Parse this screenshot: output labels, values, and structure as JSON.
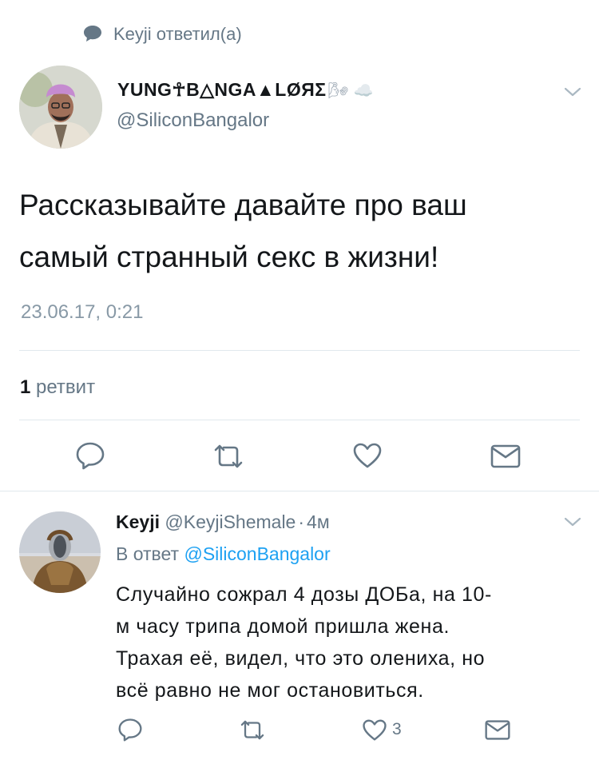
{
  "retweet_context": {
    "icon": "speech-bubble-icon",
    "text": "Keyji ответил(а)"
  },
  "main_tweet": {
    "display_name": "YUNG☥B△NGA▲LØЯΣ",
    "name_emoji": "🌬 ☁️",
    "handle": "@SiliconBangalor",
    "text_line1": "Рассказывайте давайте про ваш",
    "text_line2": "самый странный секс в жизни!",
    "timestamp": "23.06.17, 0:21",
    "retweet_count": "1",
    "retweet_label": "ретвит",
    "actions": [
      "reply-icon",
      "retweet-icon",
      "like-icon",
      "message-icon"
    ]
  },
  "reply_tweet": {
    "display_name": "Keyji",
    "handle": "@KeyjiShemale",
    "dot": "·",
    "time": "4м",
    "in_reply_prefix": "В ответ",
    "in_reply_handle": "@SiliconBangalor",
    "lines": [
      "Случайно сожрал 4 дозы ДОБа, на 10-",
      "м часу трипа домой пришла жена.",
      "Трахая её, видел, что это олениха, но",
      "всё равно не мог остановиться."
    ],
    "like_count": "3"
  },
  "colors": {
    "accent": "#1da1f2",
    "grey": "#657786",
    "divider": "#e1e8ed",
    "icon": "#657786"
  }
}
